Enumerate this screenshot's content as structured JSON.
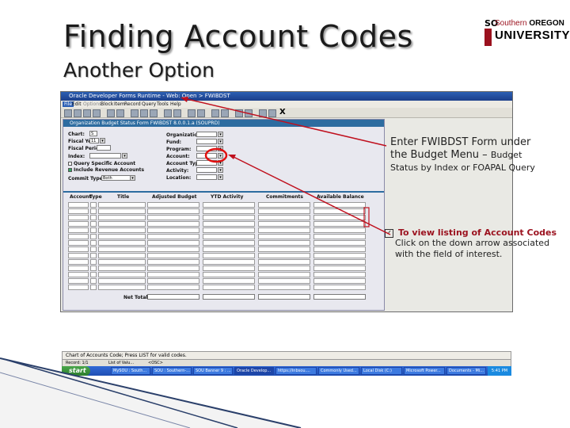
{
  "slide": {
    "title": "Finding Account Codes",
    "subtitle": "Another Option"
  },
  "logo": {
    "so": "SO",
    "line1_a": "Southern ",
    "line1_b": "OREGON",
    "line2": "UNIVERSITY"
  },
  "window": {
    "title": "Oracle Developer Forms Runtime - Web: Open > FWIBDST",
    "menu": [
      "File",
      "Edit",
      "Options",
      "Block",
      "Item",
      "Record",
      "Query",
      "Tools",
      "Help"
    ],
    "close_glyph": "X"
  },
  "form": {
    "title": "Organization Budget Status Form  FWIBDST  8.0.0.1.a  (SOUPRD)",
    "left_labels": {
      "chart": "Chart:",
      "fiscal_year": "Fiscal Year:",
      "fiscal_period": "Fiscal Period:",
      "index": "Index:",
      "query_specific": "Query Specific Account",
      "include_revenue": "Include Revenue Accounts",
      "commit_type": "Commit Type:"
    },
    "values": {
      "chart": "S",
      "fiscal_year": "11",
      "commit_type": "Both"
    },
    "right_labels": [
      "Organization:",
      "Fund:",
      "Program:",
      "Account:",
      "Account Type:",
      "Activity:",
      "Location:"
    ],
    "columns": [
      "Account",
      "Type",
      "Title",
      "Adjusted Budget",
      "YTD Activity",
      "Commitments",
      "Available Balance"
    ],
    "net_total_label": "Net Total:"
  },
  "status": {
    "message": "Chart of Accounts Code; Press LIST for valid codes.",
    "record": "Record: 1/1",
    "list": "List of Valu...",
    "osc": "<OSC>"
  },
  "taskbar": {
    "start": "start",
    "tasks": [
      "MySOU : South...",
      "SOU : Southern-...",
      "SOU Banner 9 : ...",
      "Oracle Develop...",
      "https://inbsou....",
      "Commonly Used...",
      "Local Disk (C:)",
      "Microsoft Power...",
      "Documents - Mi..."
    ],
    "clock": "5:41 PM"
  },
  "notes": {
    "note1_a": "Enter FWIBDST Form under the Budget Menu – ",
    "note1_b": "Budget Status by Index or FOAPAL Query",
    "note2_title": "To view listing of Account Codes",
    "note2_body": "Click on the down arrow associated with the field of interest."
  },
  "colors": {
    "accent_red": "#9b111e",
    "annotation_line": "#c0101e",
    "form_blue": "#2d6ca0"
  }
}
